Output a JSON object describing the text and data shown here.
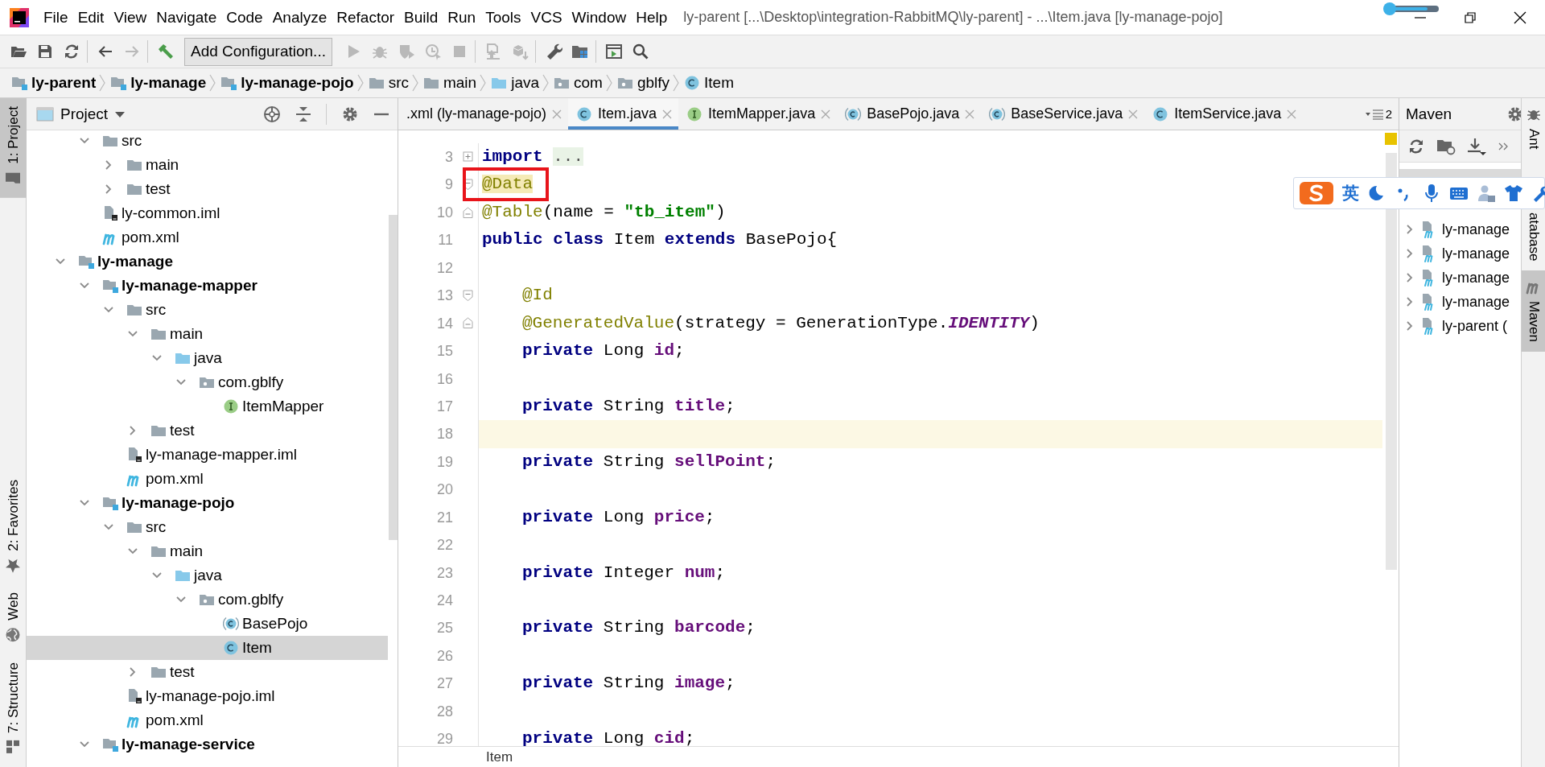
{
  "window": {
    "title": "ly-parent [...\\Desktop\\integration-RabbitMQ\\ly-parent] - ...\\Item.java [ly-manage-pojo]"
  },
  "menu": [
    "File",
    "Edit",
    "View",
    "Navigate",
    "Code",
    "Analyze",
    "Refactor",
    "Build",
    "Run",
    "Tools",
    "VCS",
    "Window",
    "Help"
  ],
  "toolbar": [
    {
      "kind": "open",
      "disabled": false
    },
    {
      "kind": "save",
      "disabled": false
    },
    {
      "kind": "sync",
      "disabled": false
    },
    {
      "kind": "separator"
    },
    {
      "kind": "back",
      "disabled": false
    },
    {
      "kind": "forward",
      "disabled": true
    },
    {
      "kind": "separator"
    },
    {
      "kind": "build",
      "disabled": false
    },
    {
      "kind": "config",
      "label": "Add Configuration...",
      "disabled": false
    },
    {
      "kind": "run",
      "disabled": true
    },
    {
      "kind": "debug",
      "disabled": true
    },
    {
      "kind": "coverage",
      "disabled": true
    },
    {
      "kind": "profile",
      "disabled": true
    },
    {
      "kind": "stop",
      "disabled": true
    },
    {
      "kind": "separator"
    },
    {
      "kind": "update",
      "disabled": true
    },
    {
      "kind": "deploy",
      "disabled": true
    },
    {
      "kind": "separator"
    },
    {
      "kind": "settings",
      "disabled": false
    },
    {
      "kind": "structure",
      "disabled": false
    },
    {
      "kind": "separator"
    },
    {
      "kind": "terminal",
      "disabled": false
    },
    {
      "kind": "search",
      "disabled": false
    }
  ],
  "breadcrumb": [
    {
      "label": "ly-parent",
      "kind": "module"
    },
    {
      "label": "ly-manage",
      "kind": "module"
    },
    {
      "label": "ly-manage-pojo",
      "kind": "module"
    },
    {
      "label": "src",
      "kind": "folder"
    },
    {
      "label": "main",
      "kind": "folder"
    },
    {
      "label": "java",
      "kind": "source"
    },
    {
      "label": "com",
      "kind": "package"
    },
    {
      "label": "gblfy",
      "kind": "package"
    },
    {
      "label": "Item",
      "kind": "class"
    }
  ],
  "left_stripe": [
    {
      "label": "1: Project",
      "kind": "project",
      "selected": true
    },
    {
      "label": "2: Favorites",
      "kind": "favorites",
      "selected": false
    },
    {
      "label": "Web",
      "kind": "web",
      "selected": false
    },
    {
      "label": "7: Structure",
      "kind": "structure",
      "selected": false
    }
  ],
  "project_panel": {
    "title": "Project",
    "tree": [
      {
        "children": [
          {
            "label": "src",
            "kind": "folder",
            "expanded": true,
            "selected": false,
            "children": [
              {
                "label": "main",
                "kind": "folder",
                "expanded": false,
                "selected": false
              },
              {
                "label": "test",
                "kind": "folder",
                "expanded": false,
                "selected": false
              }
            ]
          },
          {
            "label": "ly-common.iml",
            "kind": "iml",
            "selected": false
          },
          {
            "label": "pom.xml",
            "kind": "pom",
            "selected": false
          }
        ]
      },
      {
        "label": "ly-manage",
        "kind": "module",
        "expanded": true,
        "selected": false,
        "children": [
          {
            "label": "ly-manage-mapper",
            "kind": "module",
            "expanded": true,
            "selected": false,
            "children": [
              {
                "label": "src",
                "kind": "folder",
                "expanded": true,
                "selected": false,
                "children": [
                  {
                    "label": "main",
                    "kind": "folder",
                    "expanded": true,
                    "selected": false,
                    "children": [
                      {
                        "label": "java",
                        "kind": "source",
                        "expanded": true,
                        "selected": false,
                        "children": [
                          {
                            "label": "com.gblfy",
                            "kind": "package",
                            "expanded": true,
                            "selected": false,
                            "children": [
                              {
                                "label": "ItemMapper",
                                "kind": "interface",
                                "selected": false
                              }
                            ]
                          }
                        ]
                      }
                    ]
                  },
                  {
                    "label": "test",
                    "kind": "folder",
                    "expanded": false,
                    "selected": false
                  }
                ]
              },
              {
                "label": "ly-manage-mapper.iml",
                "kind": "iml",
                "selected": false
              },
              {
                "label": "pom.xml",
                "kind": "pom",
                "selected": false
              }
            ]
          },
          {
            "label": "ly-manage-pojo",
            "kind": "module",
            "expanded": true,
            "selected": false,
            "children": [
              {
                "label": "src",
                "kind": "folder",
                "expanded": true,
                "selected": false,
                "children": [
                  {
                    "label": "main",
                    "kind": "folder",
                    "expanded": true,
                    "selected": false,
                    "children": [
                      {
                        "label": "java",
                        "kind": "source",
                        "expanded": true,
                        "selected": false,
                        "children": [
                          {
                            "label": "com.gblfy",
                            "kind": "package",
                            "expanded": true,
                            "selected": false,
                            "children": [
                              {
                                "label": "BasePojo",
                                "kind": "abstract",
                                "selected": false
                              },
                              {
                                "label": "Item",
                                "kind": "class",
                                "selected": true
                              }
                            ]
                          }
                        ]
                      }
                    ]
                  },
                  {
                    "label": "test",
                    "kind": "folder",
                    "expanded": false,
                    "selected": false
                  }
                ]
              },
              {
                "label": "ly-manage-pojo.iml",
                "kind": "iml",
                "selected": false
              },
              {
                "label": "pom.xml",
                "kind": "pom",
                "selected": false
              }
            ]
          },
          {
            "label": "ly-manage-service",
            "kind": "module",
            "expanded": true,
            "selected": false
          }
        ]
      }
    ]
  },
  "editor": {
    "tabs": [
      {
        "label": ".xml (ly-manage-pojo)",
        "kind": "xml",
        "selected": false
      },
      {
        "label": "Item.java",
        "kind": "class",
        "selected": true
      },
      {
        "label": "ItemMapper.java",
        "kind": "interface",
        "selected": false
      },
      {
        "label": "BasePojo.java",
        "kind": "abstract",
        "selected": false
      },
      {
        "label": "BaseService.java",
        "kind": "abstract",
        "selected": false
      },
      {
        "label": "ItemService.java",
        "kind": "class",
        "selected": false
      }
    ],
    "hidden_tabs": "2",
    "lines": [
      {
        "number": "3",
        "fold": {
          "kind": "collapsed"
        },
        "indented": false,
        "current": false,
        "boxed": false,
        "tokens": [
          {
            "kind": "keyword",
            "text": "import"
          },
          {
            "kind": "folded",
            "text": "..."
          }
        ]
      },
      {
        "number": "9",
        "fold": {
          "kind": "start"
        },
        "indented": false,
        "current": false,
        "boxed": true,
        "tokens": [
          {
            "kind": "annotation",
            "text": "@Data",
            "highlighted": true
          }
        ]
      },
      {
        "number": "10",
        "fold": {
          "kind": "end"
        },
        "indented": false,
        "current": false,
        "boxed": false,
        "tokens": [
          {
            "kind": "annotation",
            "text": "@Table"
          },
          {
            "kind": "plain",
            "text": "(name = "
          },
          {
            "kind": "string",
            "text": "\"tb_item\""
          },
          {
            "kind": "plain",
            "text": ")"
          }
        ]
      },
      {
        "number": "11",
        "indented": false,
        "current": false,
        "boxed": false,
        "tokens": [
          {
            "kind": "keyword",
            "text": "public class"
          },
          {
            "kind": "plain",
            "text": " Item "
          },
          {
            "kind": "keyword",
            "text": "extends"
          },
          {
            "kind": "plain",
            "text": " BasePojo{"
          }
        ]
      },
      {
        "number": "12",
        "current": false,
        "boxed": false
      },
      {
        "number": "13",
        "fold": {
          "kind": "start"
        },
        "indented": true,
        "current": false,
        "boxed": false,
        "tokens": [
          {
            "kind": "annotation",
            "text": "@Id"
          }
        ]
      },
      {
        "number": "14",
        "fold": {
          "kind": "end"
        },
        "indented": true,
        "current": false,
        "boxed": false,
        "tokens": [
          {
            "kind": "annotation",
            "text": "@GeneratedValue"
          },
          {
            "kind": "plain",
            "text": "(strategy = GenerationType."
          },
          {
            "kind": "static",
            "text": "IDENTITY"
          },
          {
            "kind": "plain",
            "text": ")"
          }
        ]
      },
      {
        "number": "15",
        "indented": true,
        "current": false,
        "boxed": false,
        "tokens": [
          {
            "kind": "keyword",
            "text": "private"
          },
          {
            "kind": "plain",
            "text": " Long "
          },
          {
            "kind": "field",
            "text": "id"
          },
          {
            "kind": "plain",
            "text": ";"
          }
        ]
      },
      {
        "number": "16",
        "current": false,
        "boxed": false
      },
      {
        "number": "17",
        "indented": true,
        "current": false,
        "boxed": false,
        "tokens": [
          {
            "kind": "keyword",
            "text": "private"
          },
          {
            "kind": "plain",
            "text": " String "
          },
          {
            "kind": "field",
            "text": "title"
          },
          {
            "kind": "plain",
            "text": ";"
          }
        ]
      },
      {
        "number": "18",
        "current": true,
        "boxed": false
      },
      {
        "number": "19",
        "indented": true,
        "current": false,
        "boxed": false,
        "tokens": [
          {
            "kind": "keyword",
            "text": "private"
          },
          {
            "kind": "plain",
            "text": " String "
          },
          {
            "kind": "field",
            "text": "sellPoint"
          },
          {
            "kind": "plain",
            "text": ";"
          }
        ]
      },
      {
        "number": "20",
        "current": false,
        "boxed": false
      },
      {
        "number": "21",
        "indented": true,
        "current": false,
        "boxed": false,
        "tokens": [
          {
            "kind": "keyword",
            "text": "private"
          },
          {
            "kind": "plain",
            "text": " Long "
          },
          {
            "kind": "field",
            "text": "price"
          },
          {
            "kind": "plain",
            "text": ";"
          }
        ]
      },
      {
        "number": "22",
        "current": false,
        "boxed": false
      },
      {
        "number": "23",
        "indented": true,
        "current": false,
        "boxed": false,
        "tokens": [
          {
            "kind": "keyword",
            "text": "private"
          },
          {
            "kind": "plain",
            "text": " Integer "
          },
          {
            "kind": "field",
            "text": "num"
          },
          {
            "kind": "plain",
            "text": ";"
          }
        ]
      },
      {
        "number": "24",
        "current": false,
        "boxed": false
      },
      {
        "number": "25",
        "indented": true,
        "current": false,
        "boxed": false,
        "tokens": [
          {
            "kind": "keyword",
            "text": "private"
          },
          {
            "kind": "plain",
            "text": " String "
          },
          {
            "kind": "field",
            "text": "barcode"
          },
          {
            "kind": "plain",
            "text": ";"
          }
        ]
      },
      {
        "number": "26",
        "current": false,
        "boxed": false
      },
      {
        "number": "27",
        "indented": true,
        "current": false,
        "boxed": false,
        "tokens": [
          {
            "kind": "keyword",
            "text": "private"
          },
          {
            "kind": "plain",
            "text": " String "
          },
          {
            "kind": "field",
            "text": "image"
          },
          {
            "kind": "plain",
            "text": ";"
          }
        ]
      },
      {
        "number": "28",
        "current": false,
        "boxed": false
      },
      {
        "number": "29",
        "indented": true,
        "current": false,
        "boxed": false,
        "tokens": [
          {
            "kind": "keyword",
            "text": "private"
          },
          {
            "kind": "plain",
            "text": " Long "
          },
          {
            "kind": "field",
            "text": "cid"
          },
          {
            "kind": "plain",
            "text": ";"
          }
        ]
      }
    ],
    "breadcrumb": "Item"
  },
  "maven_panel": {
    "title": "Maven",
    "items": [
      {
        "selected": true
      },
      {
        "selected": false
      },
      {
        "label": "ly-manage",
        "expanded": false,
        "selected": false
      },
      {
        "label": "ly-manage",
        "expanded": false,
        "selected": false
      },
      {
        "label": "ly-manage",
        "expanded": false,
        "selected": false
      },
      {
        "label": "ly-manage",
        "expanded": false,
        "selected": false
      },
      {
        "label": "ly-parent (",
        "expanded": false,
        "selected": false
      }
    ]
  },
  "right_stripe": [
    {
      "label": "Ant",
      "kind": "ant",
      "selected": false
    },
    {
      "label": "atabase",
      "kind": "database",
      "selected": false
    },
    {
      "label": "Maven",
      "kind": "maven",
      "selected": true
    }
  ],
  "ime_toolbar": {
    "language": "英"
  }
}
